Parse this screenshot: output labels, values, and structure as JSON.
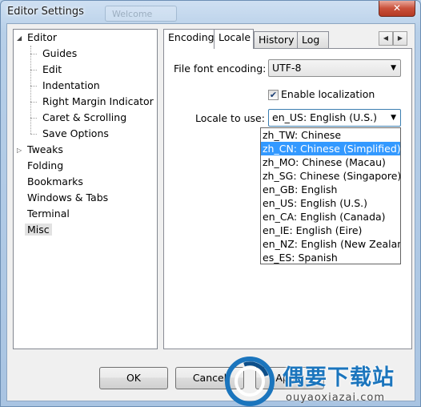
{
  "window": {
    "title": "Editor Settings",
    "ghost_tab": "Welcome"
  },
  "tree": {
    "items": [
      {
        "label": "Editor",
        "level": 0,
        "expander": "◢"
      },
      {
        "label": "Guides",
        "level": 1
      },
      {
        "label": "Edit",
        "level": 1
      },
      {
        "label": "Indentation",
        "level": 1
      },
      {
        "label": "Right Margin Indicator",
        "level": 1
      },
      {
        "label": "Caret & Scrolling",
        "level": 1
      },
      {
        "label": "Save Options",
        "level": 1
      },
      {
        "label": "Tweaks",
        "level": 0,
        "expander": "▷"
      },
      {
        "label": "Folding",
        "level": 0
      },
      {
        "label": "Bookmarks",
        "level": 0
      },
      {
        "label": "Windows & Tabs",
        "level": 0
      },
      {
        "label": "Terminal",
        "level": 0
      },
      {
        "label": "Misc",
        "level": 0,
        "selected": true
      }
    ]
  },
  "tabs": [
    "Encoding",
    "Locale",
    "History",
    "Log"
  ],
  "active_tab": "Locale",
  "locale": {
    "file_font_encoding_label": "File font encoding:",
    "file_font_encoding_value": "UTF-8",
    "enable_localization_label": "Enable localization",
    "enable_localization_checked": true,
    "locale_label": "Locale to use:",
    "locale_value": "en_US: English (U.S.)",
    "options": [
      "zh_TW: Chinese",
      "zh_CN: Chinese (Simplified)",
      "zh_MO: Chinese (Macau)",
      "zh_SG: Chinese (Singapore)",
      "en_GB: English",
      "en_US: English (U.S.)",
      "en_CA: English (Canada)",
      "en_IE: English (Eire)",
      "en_NZ: English (New Zealand)",
      "es_ES: Spanish"
    ],
    "highlighted_index": 1
  },
  "buttons": {
    "ok": "OK",
    "cancel": "Cancel",
    "apply": "Apply"
  },
  "watermark": {
    "text": "偶要下载站",
    "url": "ouyaoxiazai.com"
  },
  "colors": {
    "highlight": "#3399ff",
    "title_close": "#c9503a",
    "watermark_blue": "#1b75bd"
  }
}
